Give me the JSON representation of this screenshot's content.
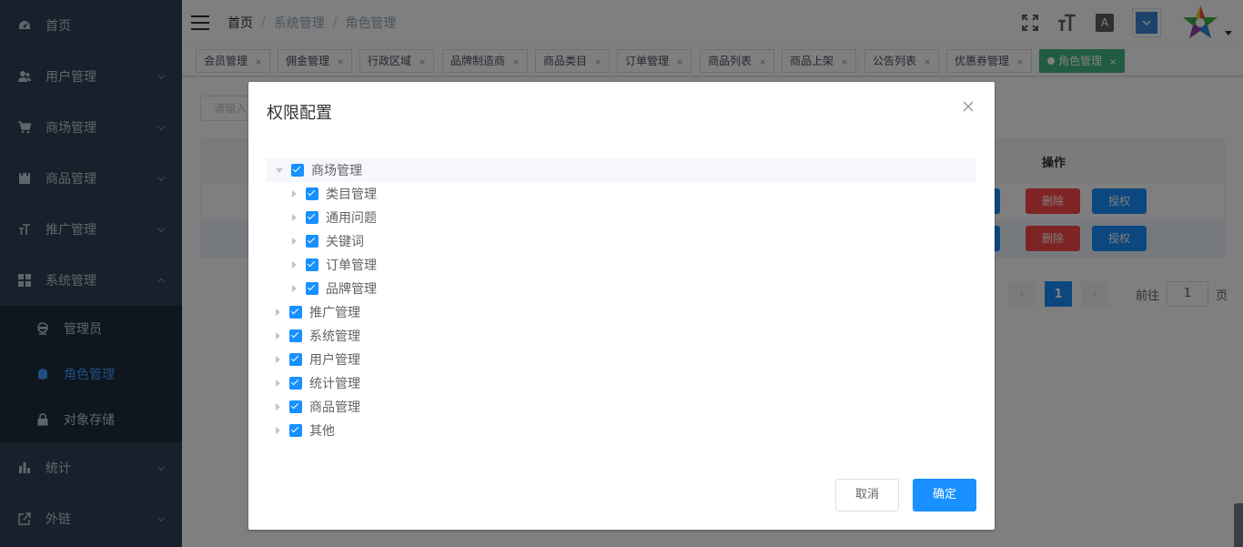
{
  "sidebar": {
    "items": [
      {
        "label": "首页",
        "icon": "dashboard-icon"
      },
      {
        "label": "用户管理",
        "icon": "user-icon"
      },
      {
        "label": "商场管理",
        "icon": "cart-icon"
      },
      {
        "label": "商品管理",
        "icon": "box-icon"
      },
      {
        "label": "推广管理",
        "icon": "text-size-icon"
      },
      {
        "label": "系统管理",
        "icon": "grid-icon"
      },
      {
        "label": "统计",
        "icon": "bar-chart-icon"
      },
      {
        "label": "外链",
        "icon": "external-link-icon"
      }
    ],
    "submenu": [
      {
        "label": "管理员",
        "icon": "admin-icon"
      },
      {
        "label": "角色管理",
        "icon": "role-icon"
      },
      {
        "label": "对象存储",
        "icon": "lock-icon"
      }
    ]
  },
  "header": {
    "breadcrumb": [
      "首页",
      "系统管理",
      "角色管理"
    ]
  },
  "tags": [
    {
      "label": "会员管理"
    },
    {
      "label": "佣金管理"
    },
    {
      "label": "行政区域"
    },
    {
      "label": "品牌制造商"
    },
    {
      "label": "商品类目"
    },
    {
      "label": "订单管理"
    },
    {
      "label": "商品列表"
    },
    {
      "label": "商品上架"
    },
    {
      "label": "公告列表"
    },
    {
      "label": "优惠券管理"
    },
    {
      "label": "角色管理"
    }
  ],
  "main": {
    "search_placeholder": "请输入",
    "op_header": "操作",
    "rows": [
      {
        "delete": "删除",
        "auth": "授权"
      },
      {
        "delete": "删除",
        "auth": "授权"
      }
    ],
    "pager": {
      "page": "1",
      "goto_prefix": "前往",
      "goto_value": "1",
      "goto_suffix": "页"
    }
  },
  "dialog": {
    "title": "权限配置",
    "tree": [
      {
        "label": "商场管理",
        "expanded": true,
        "checked": true
      },
      {
        "label": "类目管理",
        "checked": true
      },
      {
        "label": "通用问题",
        "checked": true
      },
      {
        "label": "关键词",
        "checked": true
      },
      {
        "label": "订单管理",
        "checked": true
      },
      {
        "label": "品牌管理",
        "checked": true
      },
      {
        "label": "推广管理",
        "checked": true
      },
      {
        "label": "系统管理",
        "checked": true
      },
      {
        "label": "用户管理",
        "checked": true
      },
      {
        "label": "统计管理",
        "checked": true
      },
      {
        "label": "商品管理",
        "checked": true
      },
      {
        "label": "其他",
        "checked": true
      }
    ],
    "cancel_label": "取消",
    "confirm_label": "确定"
  },
  "colors": {
    "sidebar_bg": "#304156",
    "primary": "#1890ff",
    "danger": "#ff4949",
    "active_tag": "#42b983"
  }
}
